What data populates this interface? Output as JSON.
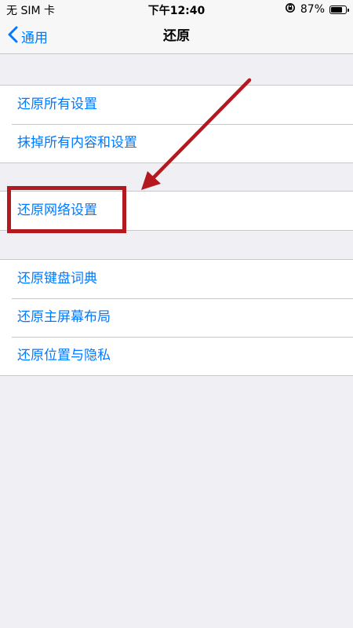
{
  "status_bar": {
    "carrier": "无 SIM 卡",
    "time": "下午12:40",
    "battery_percent_label": "87%",
    "battery_level": 0.87
  },
  "nav": {
    "back_label": "通用",
    "title": "还原"
  },
  "groups": [
    {
      "items": [
        {
          "label": "还原所有设置"
        },
        {
          "label": "抹掉所有内容和设置"
        }
      ]
    },
    {
      "items": [
        {
          "label": "还原网络设置"
        }
      ]
    },
    {
      "items": [
        {
          "label": "还原键盘词典"
        },
        {
          "label": "还原主屏幕布局"
        },
        {
          "label": "还原位置与隐私"
        }
      ]
    }
  ],
  "annotation": {
    "color": "#b3191f",
    "highlighted_item": "还原网络设置"
  },
  "colors": {
    "accent": "#007aff",
    "background": "#efeff4"
  },
  "icons": {
    "back": "chevron-left-icon",
    "orientation_lock": "orientation-lock-icon",
    "battery": "battery-icon"
  }
}
